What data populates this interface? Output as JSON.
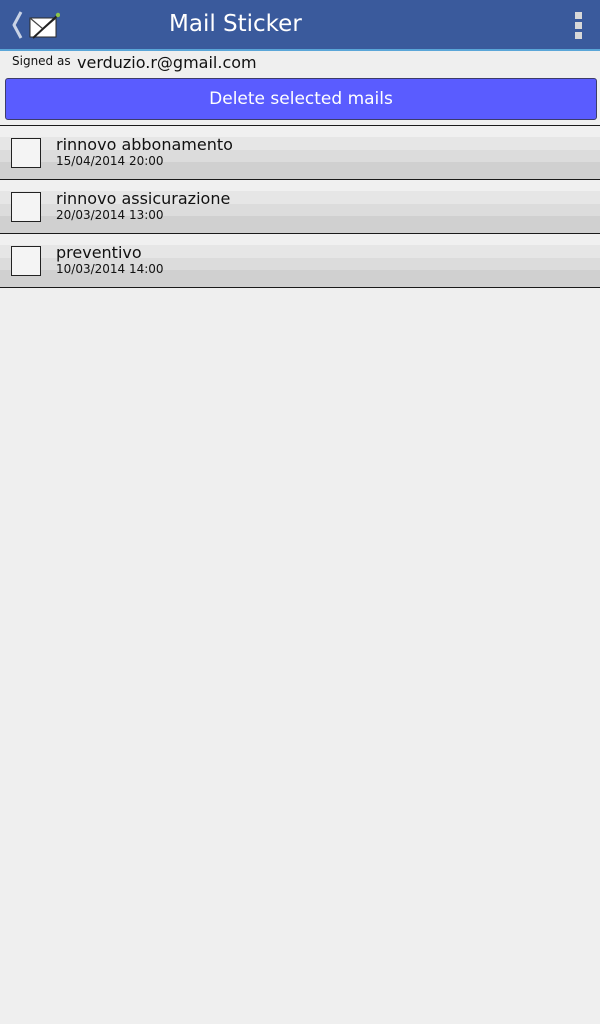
{
  "app": {
    "title": "Mail Sticker"
  },
  "account": {
    "signed_label": "Signed as",
    "email": "verduzio.r@gmail.com"
  },
  "actions": {
    "delete_label": "Delete selected mails"
  },
  "mails": [
    {
      "subject": "rinnovo abbonamento",
      "date": "15/04/2014 20:00",
      "checked": false
    },
    {
      "subject": "rinnovo assicurazione",
      "date": "20/03/2014 13:00",
      "checked": false
    },
    {
      "subject": "preventivo",
      "date": "10/03/2014 14:00",
      "checked": false
    }
  ],
  "colors": {
    "action_bar": "#3a5a9c",
    "action_bar_accent": "#5aa6d8",
    "delete_button": "#5a5cff",
    "background": "#efefef"
  },
  "icons": {
    "up": "chevron-left-icon",
    "app": "envelope-pen-icon",
    "overflow": "overflow-menu-icon"
  }
}
